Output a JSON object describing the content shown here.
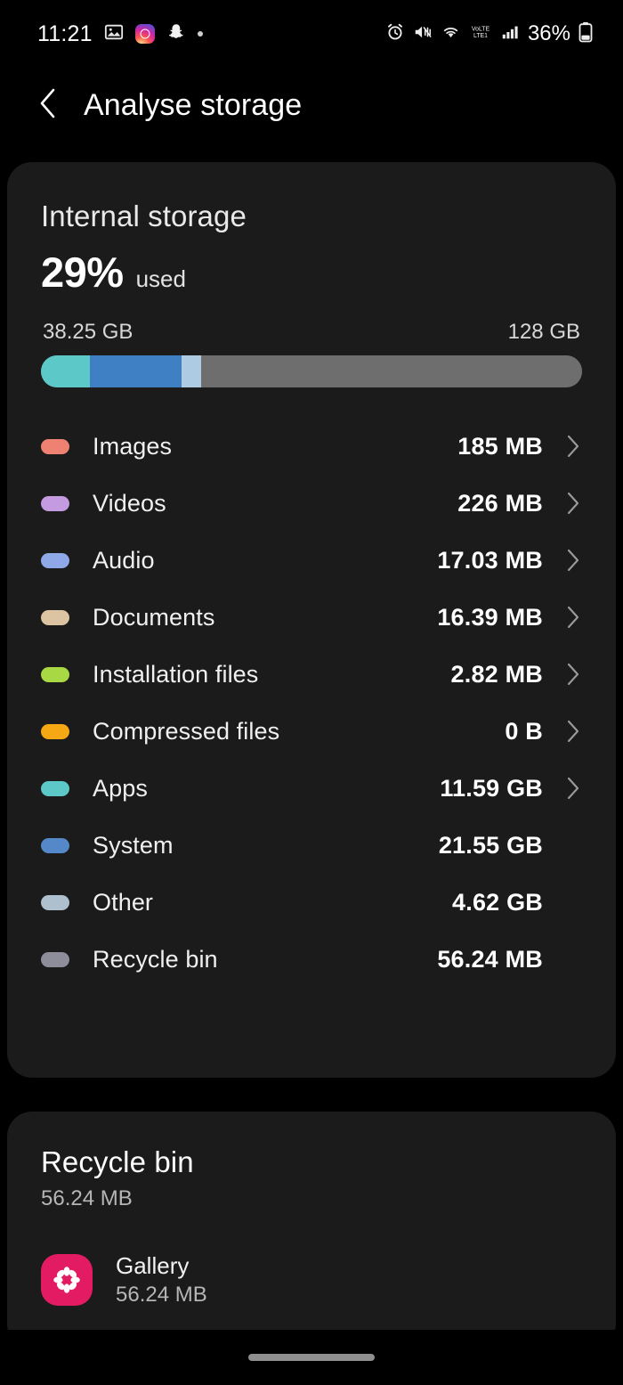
{
  "status_bar": {
    "time": "11:21",
    "battery_percent": "36%",
    "left_icons": [
      "photo-icon",
      "instagram-icon",
      "snapchat-icon",
      "more-dot-icon"
    ],
    "right_icons": [
      "alarm-icon",
      "mute-icon",
      "wifi-icon",
      "volte-icon",
      "signal-icon",
      "battery-icon"
    ]
  },
  "header": {
    "title": "Analyse storage",
    "back_icon": "chevron-left-icon"
  },
  "storage": {
    "title": "Internal storage",
    "percent_used": "29%",
    "used_label": "used",
    "used_capacity": "38.25 GB",
    "total_capacity": "128 GB",
    "bar_segments": [
      {
        "name": "apps",
        "color": "#5cc8c8",
        "percent": 9.1
      },
      {
        "name": "system",
        "color": "#3f7fc4",
        "percent": 16.9
      },
      {
        "name": "other",
        "color": "#aecbe4",
        "percent": 3.6
      },
      {
        "name": "free",
        "color": "#6e6e6e",
        "percent": 70.4
      }
    ],
    "track_color": "#6e6e6e",
    "categories": [
      {
        "label": "Images",
        "value": "185 MB",
        "color": "#ef8173",
        "chevron": true
      },
      {
        "label": "Videos",
        "value": "226 MB",
        "color": "#c49ae0",
        "chevron": true
      },
      {
        "label": "Audio",
        "value": "17.03 MB",
        "color": "#8fa8e8",
        "chevron": true
      },
      {
        "label": "Documents",
        "value": "16.39 MB",
        "color": "#dcc3a1",
        "chevron": true
      },
      {
        "label": "Installation files",
        "value": "2.82 MB",
        "color": "#a8d843",
        "chevron": true
      },
      {
        "label": "Compressed files",
        "value": "0 B",
        "color": "#f5a814",
        "chevron": true
      },
      {
        "label": "Apps",
        "value": "11.59 GB",
        "color": "#5cc8c8",
        "chevron": true
      },
      {
        "label": "System",
        "value": "21.55 GB",
        "color": "#5588c8",
        "chevron": false
      },
      {
        "label": "Other",
        "value": "4.62 GB",
        "color": "#aebfcd",
        "chevron": false
      },
      {
        "label": "Recycle bin",
        "value": "56.24 MB",
        "color": "#8e8e9a",
        "chevron": false
      }
    ]
  },
  "recycle_bin": {
    "title": "Recycle bin",
    "size": "56.24 MB",
    "apps": [
      {
        "name": "Gallery",
        "size": "56.24 MB",
        "icon": "gallery-flower-icon",
        "icon_color": "#e31b62"
      }
    ]
  },
  "nav_bar": {
    "home_indicator": "home-indicator"
  }
}
